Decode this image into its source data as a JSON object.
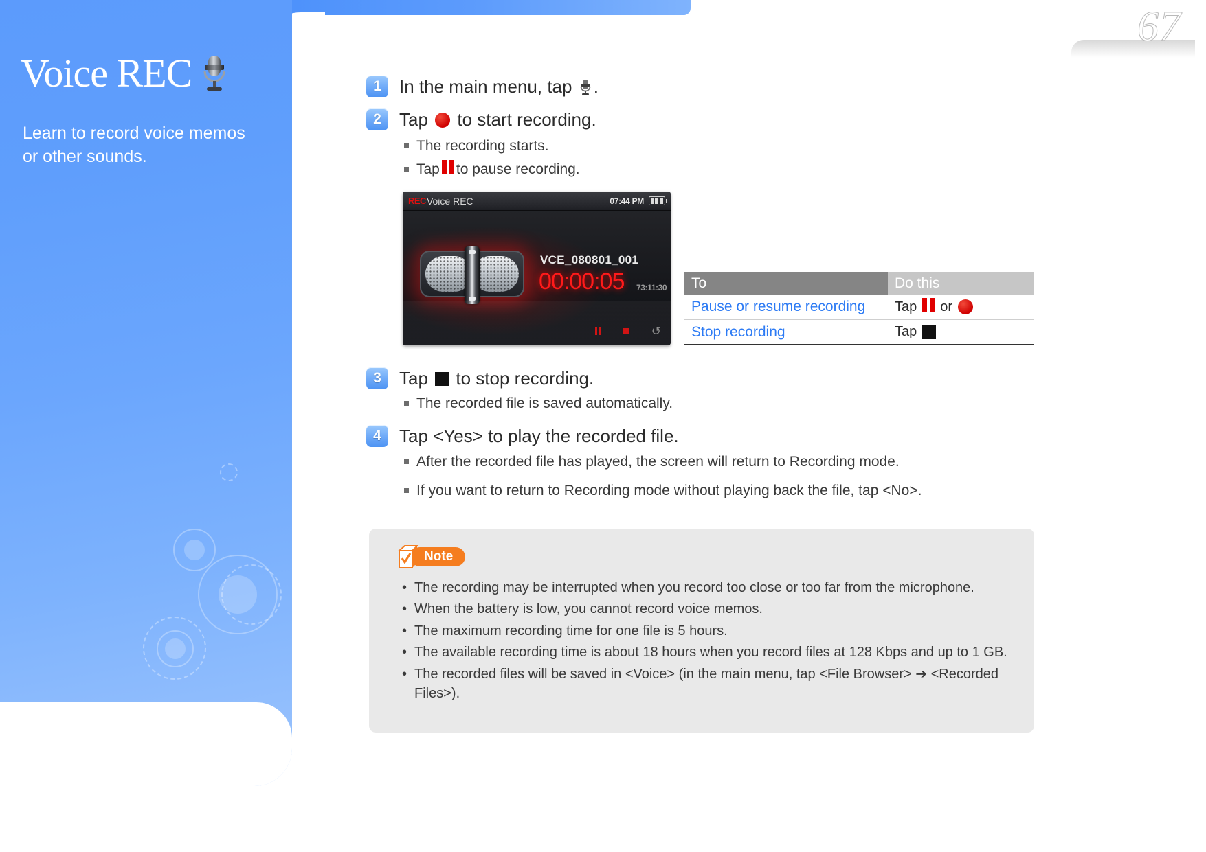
{
  "page": {
    "number": "67"
  },
  "sidebar": {
    "title": "Voice REC",
    "title_icon": "microphone-icon",
    "subtitle": "Learn to record voice memos or other sounds."
  },
  "steps": [
    {
      "num": "1",
      "text_before": "In the main menu, tap",
      "icon": "microphone-icon",
      "text_after": ".",
      "subitems": []
    },
    {
      "num": "2",
      "text_before": "Tap",
      "icon": "record-button-icon",
      "text_after": "to start recording.",
      "subitems": [
        {
          "before": "The recording starts.",
          "icon": "",
          "after": ""
        },
        {
          "before": "Tap",
          "icon": "pause-button-icon",
          "after": "to pause recording."
        }
      ]
    },
    {
      "num": "3",
      "text_before": "Tap",
      "icon": "stop-button-icon",
      "text_after": "to stop recording.",
      "subitems": [
        {
          "before": "The recorded file is saved automatically.",
          "icon": "",
          "after": ""
        }
      ]
    },
    {
      "num": "4",
      "text_before": "Tap <Yes> to play the recorded file.",
      "icon": "",
      "text_after": "",
      "subitems": [
        {
          "before": "After the recorded file has played, the screen will return to Recording mode.",
          "icon": "",
          "after": ""
        },
        {
          "before": "If you want to return to Recording mode without playing back the file, tap <No>.",
          "icon": "",
          "after": ""
        }
      ]
    }
  ],
  "device": {
    "rec_label": "REC",
    "app_title": "Voice REC",
    "clock": "07:44 PM",
    "filename": "VCE_080801_001",
    "counter": "00:00:05",
    "remaining": "73:11:30",
    "controls": [
      "pause-icon",
      "stop-icon",
      "back-icon"
    ]
  },
  "table": {
    "headers": [
      "To",
      "Do this"
    ],
    "rows": [
      {
        "to": "Pause or resume recording",
        "do_prefix": "Tap",
        "do_icon_a": "pause-button-icon",
        "do_mid": "or",
        "do_icon_b": "record-button-icon"
      },
      {
        "to": "Stop recording",
        "do_prefix": "Tap",
        "do_icon_a": "stop-button-icon",
        "do_mid": "",
        "do_icon_b": ""
      }
    ]
  },
  "note": {
    "label": "Note",
    "icon": "note-checkbox-icon",
    "items": [
      "The recording may be interrupted when you record too close or too far from the microphone.",
      "When the battery is low, you cannot record voice memos.",
      "The maximum recording time for one file is 5 hours.",
      "The available recording time is about 18 hours when you record files at 128 Kbps and up to 1 GB.",
      "The recorded files will be saved in <Voice> (in the main menu, tap <File Browser> ➔ <Recorded Files>)."
    ]
  },
  "colors": {
    "brand_blue": "#5c9bfc",
    "link_blue": "#2d7bf4",
    "accent_orange": "#f57d1f",
    "rec_red": "#cf0000"
  }
}
